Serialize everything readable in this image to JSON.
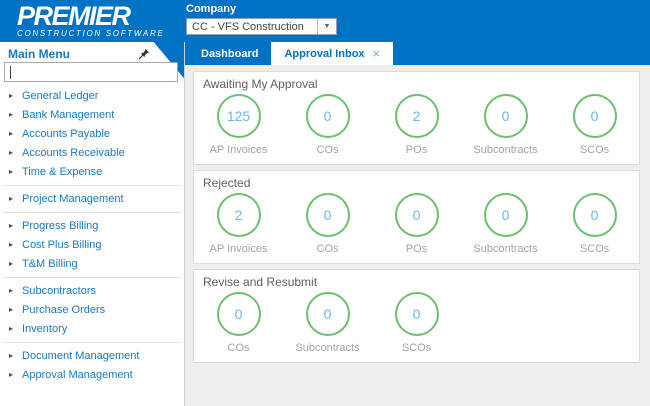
{
  "header": {
    "logo_title": "PREMIER",
    "logo_subtitle": "CONSTRUCTION SOFTWARE",
    "company": {
      "label": "Company",
      "selected": "CC - VFS Construction",
      "dropdown_icon": "▼"
    }
  },
  "tabs": [
    {
      "label": "Dashboard",
      "active": false
    },
    {
      "label": "Approval Inbox",
      "active": true,
      "close_icon": "×"
    }
  ],
  "sidebar": {
    "title": "Main Menu",
    "pin_icon": "pushpin-icon",
    "search": {
      "value": "",
      "placeholder": ""
    },
    "item_arrow_icon": "▸",
    "groups": [
      {
        "items": [
          "General Ledger",
          "Bank Management",
          "Accounts Payable",
          "Accounts Receivable",
          "Time & Expense"
        ]
      },
      {
        "items": [
          "Project Management"
        ]
      },
      {
        "items": [
          "Progress Billing",
          "Cost Plus Billing",
          "T&M Billing"
        ]
      },
      {
        "items": [
          "Subcontractors",
          "Purchase Orders",
          "Inventory"
        ]
      },
      {
        "items": [
          "Document Management",
          "Approval Management"
        ]
      }
    ]
  },
  "dashboard": {
    "sections": [
      {
        "title": "Awaiting My Approval",
        "counters": [
          {
            "value": "125",
            "label": "AP Invoices"
          },
          {
            "value": "0",
            "label": "COs"
          },
          {
            "value": "2",
            "label": "POs"
          },
          {
            "value": "0",
            "label": "Subcontracts"
          },
          {
            "value": "0",
            "label": "SCOs"
          }
        ]
      },
      {
        "title": "Rejected",
        "counters": [
          {
            "value": "2",
            "label": "AP Invoices"
          },
          {
            "value": "0",
            "label": "COs"
          },
          {
            "value": "0",
            "label": "POs"
          },
          {
            "value": "0",
            "label": "Subcontracts"
          },
          {
            "value": "0",
            "label": "SCOs"
          }
        ]
      },
      {
        "title": "Revise and Resubmit",
        "counters": [
          {
            "value": "0",
            "label": "COs"
          },
          {
            "value": "0",
            "label": "Subcontracts"
          },
          {
            "value": "0",
            "label": "SCOs"
          }
        ]
      }
    ]
  },
  "colors": {
    "header_blue": "#0072C4",
    "link_blue": "#1779C1",
    "circle_green": "#6BBF6E",
    "count_blue": "#6FB5E8",
    "label_gray": "#A3A3A3",
    "content_bg": "#EEEEEE"
  }
}
